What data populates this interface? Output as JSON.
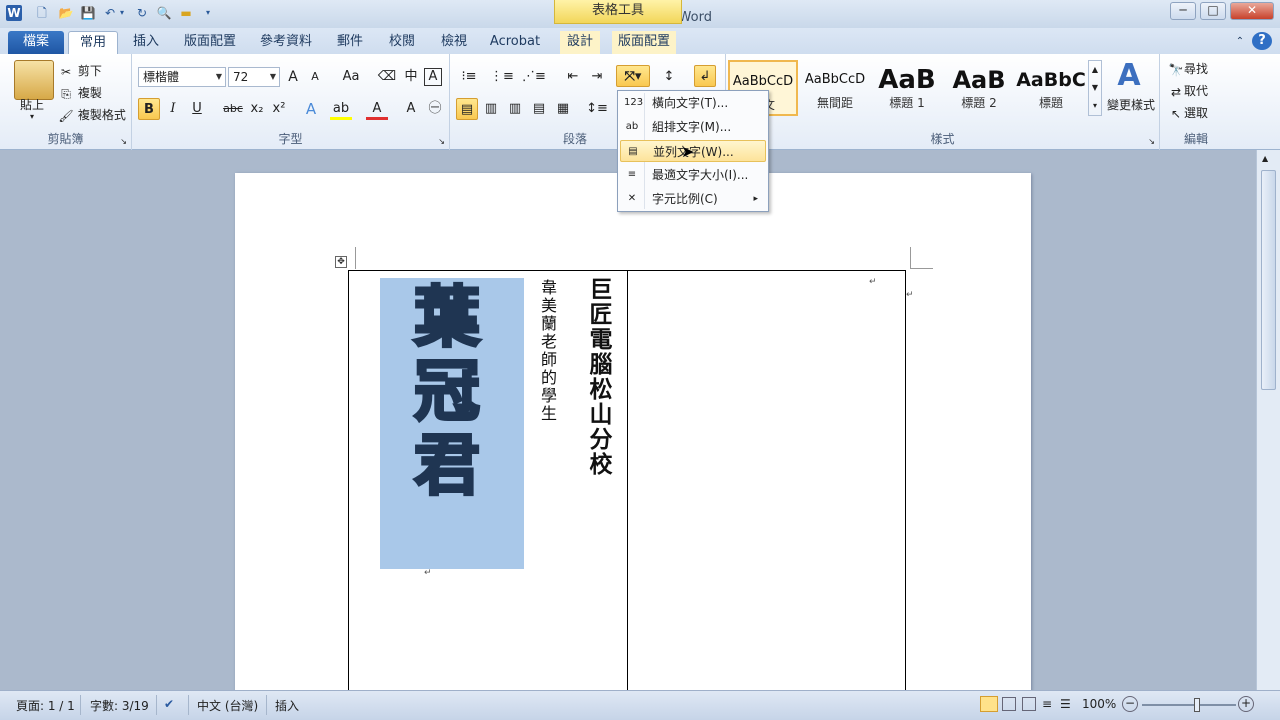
{
  "window": {
    "title": "文件2 - Microsoft Word",
    "context_header": "表格工具",
    "min": "─",
    "max": "□",
    "close": "✕"
  },
  "qat": {
    "undo_arrow": "▾",
    "more": "▾"
  },
  "tabs": [
    {
      "label": "檔案"
    },
    {
      "label": "常用"
    },
    {
      "label": "插入"
    },
    {
      "label": "版面配置"
    },
    {
      "label": "參考資料"
    },
    {
      "label": "郵件"
    },
    {
      "label": "校閱"
    },
    {
      "label": "檢視"
    },
    {
      "label": "Acrobat"
    },
    {
      "label": "設計"
    },
    {
      "label": "版面配置"
    }
  ],
  "clipboard": {
    "paste": "貼上",
    "cut": "剪下",
    "copy": "複製",
    "format_painter": "複製格式",
    "label": "剪貼簿"
  },
  "font": {
    "name": "標楷體",
    "size": "72",
    "label": "字型",
    "bold": "B",
    "italic": "I",
    "underline": "U",
    "strike": "abc",
    "sub": "x₂",
    "sup": "x²",
    "grow": "A",
    "shrink": "A",
    "case": "Aa",
    "font_color": "A",
    "highlight": "ab"
  },
  "paragraph": {
    "label": "段落"
  },
  "styles": {
    "label": "樣式",
    "change": "變更樣式",
    "items": [
      {
        "sample": "AaBbCcD",
        "name": "內文"
      },
      {
        "sample": "AaBbCcD",
        "name": "無間距"
      },
      {
        "sample": "AaB",
        "name": "標題 1"
      },
      {
        "sample": "AaB",
        "name": "標題 2"
      },
      {
        "sample": "AaBbC",
        "name": "標題"
      }
    ]
  },
  "editing": {
    "label": "編輯",
    "find": "尋找",
    "replace": "取代",
    "select": "選取"
  },
  "menu": {
    "items": [
      {
        "icon": "123",
        "label": "橫向文字(T)..."
      },
      {
        "icon": "ab",
        "label": "組排文字(M)..."
      },
      {
        "icon": "▤",
        "label": "並列文字(W)..."
      },
      {
        "icon": "≡",
        "label": "最適文字大小(I)..."
      },
      {
        "icon": "✕",
        "label": "字元比例(C)",
        "arrow": "▸"
      }
    ]
  },
  "document": {
    "big_name": "葉冠君",
    "line1": "巨匠電腦松山分校",
    "line2": "韋美蘭老師的學生",
    "para_mark": "↵"
  },
  "status": {
    "page": "頁面: 1 / 1",
    "words": "字數: 3/19",
    "lang": "中文 (台灣)",
    "insert": "插入",
    "zoom": "100%",
    "zoom_level_pct": 100
  }
}
